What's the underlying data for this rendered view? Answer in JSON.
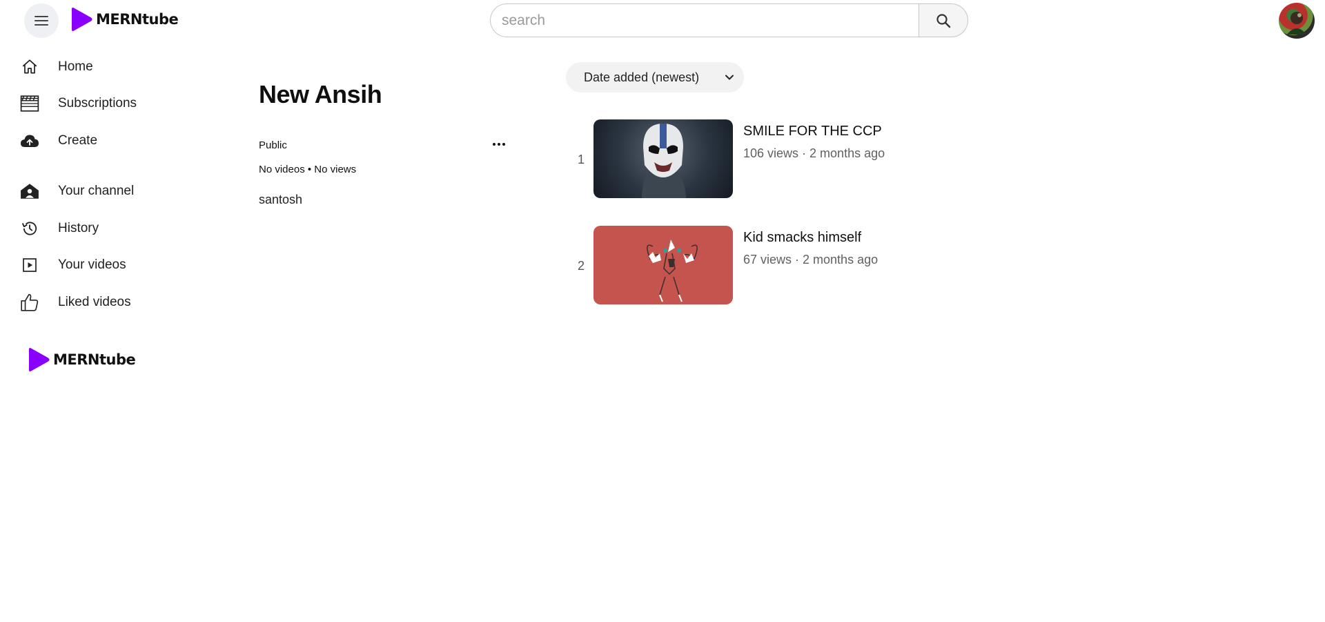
{
  "app": {
    "name": "MERNtube"
  },
  "header": {
    "search": {
      "placeholder": "search",
      "value": ""
    }
  },
  "sidebar": {
    "items": [
      {
        "label": "Home",
        "icon": "home-icon"
      },
      {
        "label": "Subscriptions",
        "icon": "clapperboard-icon"
      },
      {
        "label": "Create",
        "icon": "cloud-upload-icon"
      }
    ],
    "items2": [
      {
        "label": "Your channel",
        "icon": "channel-icon"
      },
      {
        "label": "History",
        "icon": "history-icon"
      },
      {
        "label": "Your videos",
        "icon": "play-square-icon"
      },
      {
        "label": "Liked videos",
        "icon": "thumbs-up-icon"
      }
    ]
  },
  "playlist": {
    "title": "New Ansih",
    "privacy": "Public",
    "stats": "No videos • No views",
    "owner": "santosh"
  },
  "sort": {
    "selected": "Date added (newest)"
  },
  "videos": [
    {
      "index": "1",
      "title": "SMILE FOR THE CCP",
      "meta": "106 views · 2 months ago",
      "thumb_color": "#2a3440"
    },
    {
      "index": "2",
      "title": "Kid smacks himself",
      "meta": "67 views · 2 months ago",
      "thumb_color": "#c4544d"
    }
  ],
  "colors": {
    "brand": "#7b00ff"
  }
}
